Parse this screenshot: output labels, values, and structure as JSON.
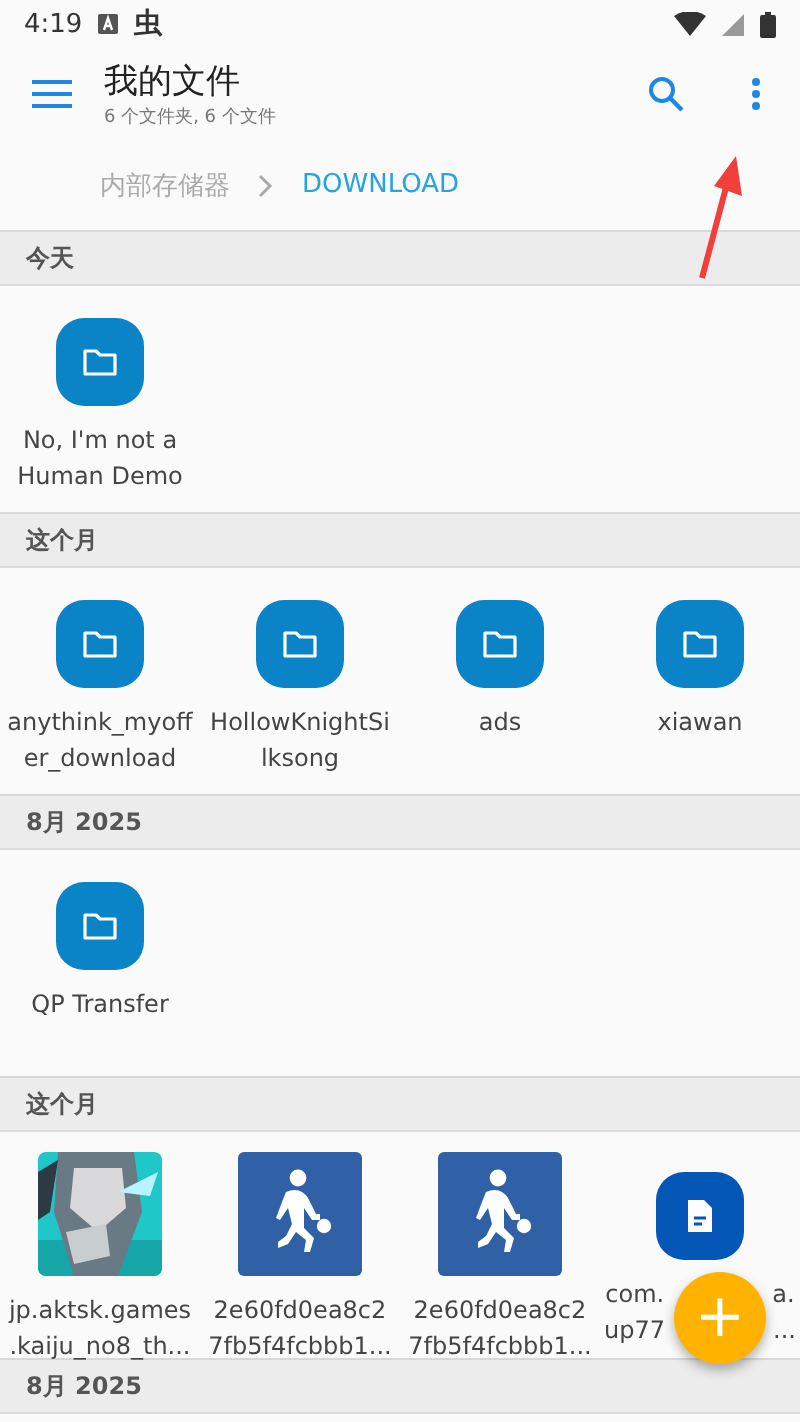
{
  "status_bar": {
    "time": "4:19",
    "notification_glyph": "虫"
  },
  "toolbar": {
    "title": "我的文件",
    "subtitle": "6 个文件夹, 6 个文件"
  },
  "breadcrumb": [
    {
      "label": "内部存储器",
      "selected": false
    },
    {
      "label": "DOWNLOAD",
      "selected": true
    }
  ],
  "sections": [
    {
      "header": "今天",
      "items": [
        {
          "kind": "folder",
          "lines": [
            "No, I'm not a",
            "Human Demo"
          ]
        }
      ]
    },
    {
      "header": "这个月",
      "items": [
        {
          "kind": "folder",
          "lines": [
            "anythink_myoff",
            "er_download"
          ]
        },
        {
          "kind": "folder",
          "lines": [
            "HollowKnightSi",
            "lksong"
          ]
        },
        {
          "kind": "folder",
          "lines": [
            "ads"
          ]
        },
        {
          "kind": "folder",
          "lines": [
            "xiawan"
          ]
        }
      ]
    },
    {
      "header": "8月 2025",
      "items": [
        {
          "kind": "folder",
          "lines": [
            "QP Transfer"
          ]
        }
      ]
    },
    {
      "header": "这个月",
      "items": [
        {
          "kind": "picture",
          "lines": [
            "jp.aktsk.games",
            ".kaiju_no8_th..."
          ]
        },
        {
          "kind": "player",
          "lines": [
            "2e60fd0ea8c2",
            "7fb5f4fcbbb1..."
          ]
        },
        {
          "kind": "player",
          "lines": [
            "2e60fd0ea8c2",
            "7fb5f4fcbbb1..."
          ]
        },
        {
          "kind": "document",
          "lines": [
            "com.",
            "up77"
          ],
          "line_ends": [
            "a.",
            "..."
          ]
        }
      ]
    },
    {
      "header": "8月 2025"
    }
  ],
  "fab": {
    "label": "+"
  }
}
